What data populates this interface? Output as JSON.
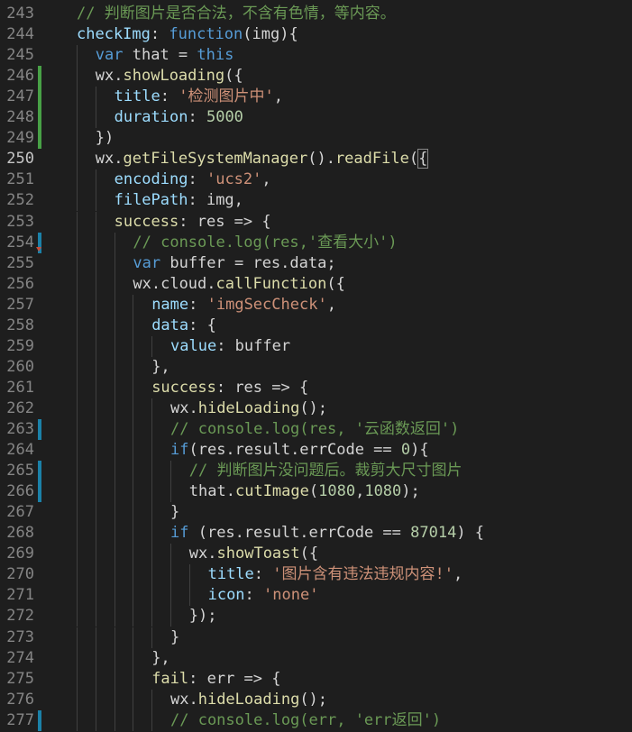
{
  "editor": {
    "lines": [
      {
        "n": "243",
        "mark": "",
        "indent": 1,
        "tokens": [
          [
            "cm",
            "// 判断图片是否合法，不含有色情，等内容。"
          ]
        ]
      },
      {
        "n": "244",
        "mark": "",
        "indent": 1,
        "tokens": [
          [
            "id",
            "checkImg"
          ],
          [
            "pn",
            ": "
          ],
          [
            "kw",
            "function"
          ],
          [
            "pn",
            "(img){"
          ]
        ]
      },
      {
        "n": "245",
        "mark": "",
        "indent": 2,
        "tokens": [
          [
            "kw",
            "var"
          ],
          [
            "pn",
            " that = "
          ],
          [
            "kw",
            "this"
          ]
        ]
      },
      {
        "n": "246",
        "mark": "added",
        "indent": 2,
        "tokens": [
          [
            "pn",
            "wx."
          ],
          [
            "fn",
            "showLoading"
          ],
          [
            "pn",
            "({"
          ]
        ]
      },
      {
        "n": "247",
        "mark": "added",
        "indent": 3,
        "tokens": [
          [
            "pr",
            "title"
          ],
          [
            "pn",
            ": "
          ],
          [
            "str",
            "'检测图片中'"
          ],
          [
            "pn",
            ","
          ]
        ]
      },
      {
        "n": "248",
        "mark": "added",
        "indent": 3,
        "tokens": [
          [
            "pr",
            "duration"
          ],
          [
            "pn",
            ": "
          ],
          [
            "num",
            "5000"
          ]
        ]
      },
      {
        "n": "249",
        "mark": "added",
        "indent": 2,
        "tokens": [
          [
            "pn",
            "})"
          ]
        ]
      },
      {
        "n": "250",
        "mark": "",
        "indent": 2,
        "active": true,
        "tokens": [
          [
            "pn",
            "wx."
          ],
          [
            "fn",
            "getFileSystemManager"
          ],
          [
            "pn",
            "()."
          ],
          [
            "fn",
            "readFile"
          ],
          [
            "pn",
            "("
          ],
          [
            "bm",
            "{"
          ]
        ]
      },
      {
        "n": "251",
        "mark": "",
        "indent": 3,
        "tokens": [
          [
            "pr",
            "encoding"
          ],
          [
            "pn",
            ": "
          ],
          [
            "str",
            "'ucs2'"
          ],
          [
            "pn",
            ","
          ]
        ]
      },
      {
        "n": "252",
        "mark": "",
        "indent": 3,
        "tokens": [
          [
            "pr",
            "filePath"
          ],
          [
            "pn",
            ": img,"
          ]
        ]
      },
      {
        "n": "253",
        "mark": "",
        "indent": 3,
        "tokens": [
          [
            "fn",
            "success"
          ],
          [
            "pn",
            ": res => {"
          ]
        ]
      },
      {
        "n": "254",
        "mark": "modified",
        "indent": 4,
        "tokens": [
          [
            "cm",
            "// console.log(res,'查看大小')"
          ]
        ]
      },
      {
        "n": "255",
        "mark": "",
        "indent": 4,
        "fold": true,
        "tokens": [
          [
            "kw",
            "var"
          ],
          [
            "pn",
            " buffer = res.data;"
          ]
        ]
      },
      {
        "n": "256",
        "mark": "",
        "indent": 4,
        "tokens": [
          [
            "pn",
            "wx.cloud."
          ],
          [
            "fn",
            "callFunction"
          ],
          [
            "pn",
            "({"
          ]
        ]
      },
      {
        "n": "257",
        "mark": "",
        "indent": 5,
        "tokens": [
          [
            "pr",
            "name"
          ],
          [
            "pn",
            ": "
          ],
          [
            "str",
            "'imgSecCheck'"
          ],
          [
            "pn",
            ","
          ]
        ]
      },
      {
        "n": "258",
        "mark": "",
        "indent": 5,
        "tokens": [
          [
            "pr",
            "data"
          ],
          [
            "pn",
            ": {"
          ]
        ]
      },
      {
        "n": "259",
        "mark": "",
        "indent": 6,
        "tokens": [
          [
            "pr",
            "value"
          ],
          [
            "pn",
            ": buffer"
          ]
        ]
      },
      {
        "n": "260",
        "mark": "",
        "indent": 5,
        "tokens": [
          [
            "pn",
            "},"
          ]
        ]
      },
      {
        "n": "261",
        "mark": "",
        "indent": 5,
        "tokens": [
          [
            "fn",
            "success"
          ],
          [
            "pn",
            ": res => {"
          ]
        ]
      },
      {
        "n": "262",
        "mark": "",
        "indent": 6,
        "tokens": [
          [
            "pn",
            "wx."
          ],
          [
            "fn",
            "hideLoading"
          ],
          [
            "pn",
            "();"
          ]
        ]
      },
      {
        "n": "263",
        "mark": "modified",
        "indent": 6,
        "tokens": [
          [
            "cm",
            "// console.log(res, '云函数返回')"
          ]
        ]
      },
      {
        "n": "264",
        "mark": "",
        "indent": 6,
        "tokens": [
          [
            "kw",
            "if"
          ],
          [
            "pn",
            "(res.result.errCode == "
          ],
          [
            "num",
            "0"
          ],
          [
            "pn",
            "){"
          ]
        ]
      },
      {
        "n": "265",
        "mark": "modified",
        "indent": 7,
        "tokens": [
          [
            "cm",
            "// 判断图片没问题后。裁剪大尺寸图片"
          ]
        ]
      },
      {
        "n": "266",
        "mark": "modified",
        "indent": 7,
        "tokens": [
          [
            "pn",
            "that."
          ],
          [
            "fn",
            "cutImage"
          ],
          [
            "pn",
            "("
          ],
          [
            "num",
            "1080"
          ],
          [
            "pn",
            ","
          ],
          [
            "num",
            "1080"
          ],
          [
            "pn",
            ");"
          ]
        ]
      },
      {
        "n": "267",
        "mark": "",
        "indent": 6,
        "tokens": [
          [
            "pn",
            "}"
          ]
        ]
      },
      {
        "n": "268",
        "mark": "",
        "indent": 6,
        "tokens": [
          [
            "kw",
            "if"
          ],
          [
            "pn",
            " (res.result.errCode == "
          ],
          [
            "num",
            "87014"
          ],
          [
            "pn",
            ") {"
          ]
        ]
      },
      {
        "n": "269",
        "mark": "",
        "indent": 7,
        "tokens": [
          [
            "pn",
            "wx."
          ],
          [
            "fn",
            "showToast"
          ],
          [
            "pn",
            "({"
          ]
        ]
      },
      {
        "n": "270",
        "mark": "",
        "indent": 8,
        "tokens": [
          [
            "pr",
            "title"
          ],
          [
            "pn",
            ": "
          ],
          [
            "str",
            "'图片含有违法违规内容!'"
          ],
          [
            "pn",
            ","
          ]
        ]
      },
      {
        "n": "271",
        "mark": "",
        "indent": 8,
        "tokens": [
          [
            "pr",
            "icon"
          ],
          [
            "pn",
            ": "
          ],
          [
            "str",
            "'none'"
          ]
        ]
      },
      {
        "n": "272",
        "mark": "",
        "indent": 7,
        "tokens": [
          [
            "pn",
            "});"
          ]
        ]
      },
      {
        "n": "273",
        "mark": "",
        "indent": 6,
        "tokens": [
          [
            "pn",
            "}"
          ]
        ]
      },
      {
        "n": "274",
        "mark": "",
        "indent": 5,
        "tokens": [
          [
            "pn",
            "},"
          ]
        ]
      },
      {
        "n": "275",
        "mark": "",
        "indent": 5,
        "tokens": [
          [
            "fn",
            "fail"
          ],
          [
            "pn",
            ": err => {"
          ]
        ]
      },
      {
        "n": "276",
        "mark": "",
        "indent": 6,
        "tokens": [
          [
            "pn",
            "wx."
          ],
          [
            "fn",
            "hideLoading"
          ],
          [
            "pn",
            "();"
          ]
        ]
      },
      {
        "n": "277",
        "mark": "modified",
        "indent": 6,
        "tokens": [
          [
            "cm",
            "// console.log(err, 'err返回')"
          ]
        ]
      }
    ]
  },
  "colors": {
    "background": "#1e1e1e",
    "keyword": "#569cd6",
    "function": "#dcdcaa",
    "property": "#9cdcfe",
    "string": "#ce9178",
    "number": "#b5cea8",
    "comment": "#6a9955",
    "gutter_added": "#48a146",
    "gutter_modified": "#1b81a8"
  }
}
